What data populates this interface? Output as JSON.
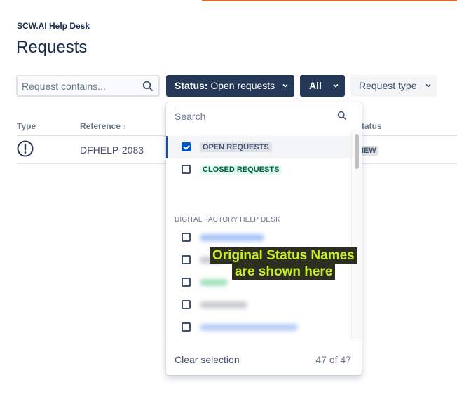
{
  "header": {
    "breadcrumb": "SCW.AI Help Desk",
    "title": "Requests"
  },
  "filters": {
    "search_placeholder": "Request contains...",
    "status_prefix": "Status:",
    "status_value": "Open requests",
    "all_label": "All",
    "request_type_label": "Request type"
  },
  "table": {
    "columns": [
      "Type",
      "Reference",
      "Status"
    ],
    "sort_indicator": "↕",
    "rows": [
      {
        "reference": "DFHELP-2083",
        "status": "NEW"
      }
    ]
  },
  "dropdown": {
    "search_placeholder": "Search",
    "options": [
      {
        "label": "OPEN REQUESTS",
        "checked": true
      },
      {
        "label": "CLOSED REQUESTS",
        "checked": false
      }
    ],
    "group_label": "DIGITAL FACTORY HELP DESK",
    "clear_label": "Clear selection",
    "count": "47 of 47"
  },
  "annotation": {
    "line1": "Original Status Names",
    "line2": "are shown here"
  },
  "colors": {
    "primary_button": "#253858",
    "accent": "#0052cc",
    "annotation_text": "#c6f024",
    "closed_lozenge": "#e3fcef"
  }
}
